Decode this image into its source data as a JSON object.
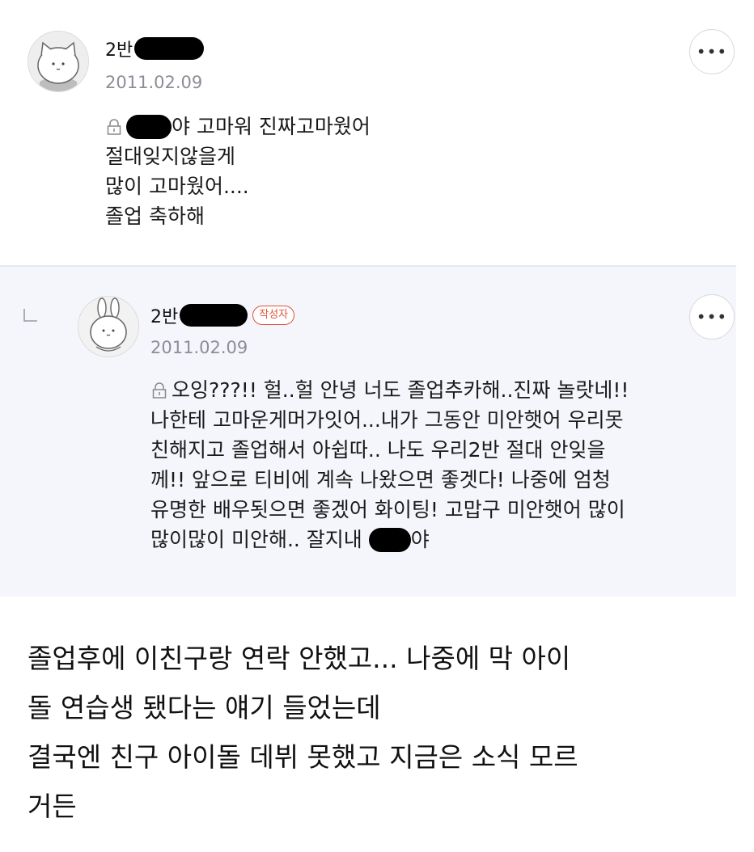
{
  "comments": [
    {
      "name": "2반",
      "date": "2011.02.09",
      "lines": [
        "야 고마워 진짜고마웠어",
        "절대잊지않을게",
        "많이 고마웠어....",
        "졸업 축하해"
      ]
    },
    {
      "name": "2반",
      "badge": "작성자",
      "date": "2011.02.09",
      "lines": [
        "오잉???!! 헐..헐 안녕 너도 졸업추카해..진짜 놀랏네!!",
        "나한테 고마운게머가잇어...내가 그동안 미안햇어 우리못",
        "친해지고 졸업해서 아쉽따.. 나도 우리2반 절대 안잊을",
        "께!! 앞으로 티비에 계속 나왔으면 좋겟다! 나중에 엄청",
        "유명한 배우됫으면 좋겠어 화이팅! 고맙구 미안햇어 많이",
        "많이많이 미안해.. 잘지내",
        "야"
      ]
    }
  ],
  "more_label": "•••",
  "caption": [
    "졸업후에 이친구랑 연락 안했고... 나중에 막 아이",
    "돌 연습생 됐다는 얘기 들었는데",
    "결국엔 친구 아이돌 데뷔 못했고 지금은 소식 모르",
    "거든"
  ],
  "icons": {
    "avatar1": "cat-avatar-icon",
    "avatar2": "rabbit-avatar-icon",
    "lock": "lock-icon",
    "reply": "reply-arrow-icon",
    "more": "more-icon"
  }
}
